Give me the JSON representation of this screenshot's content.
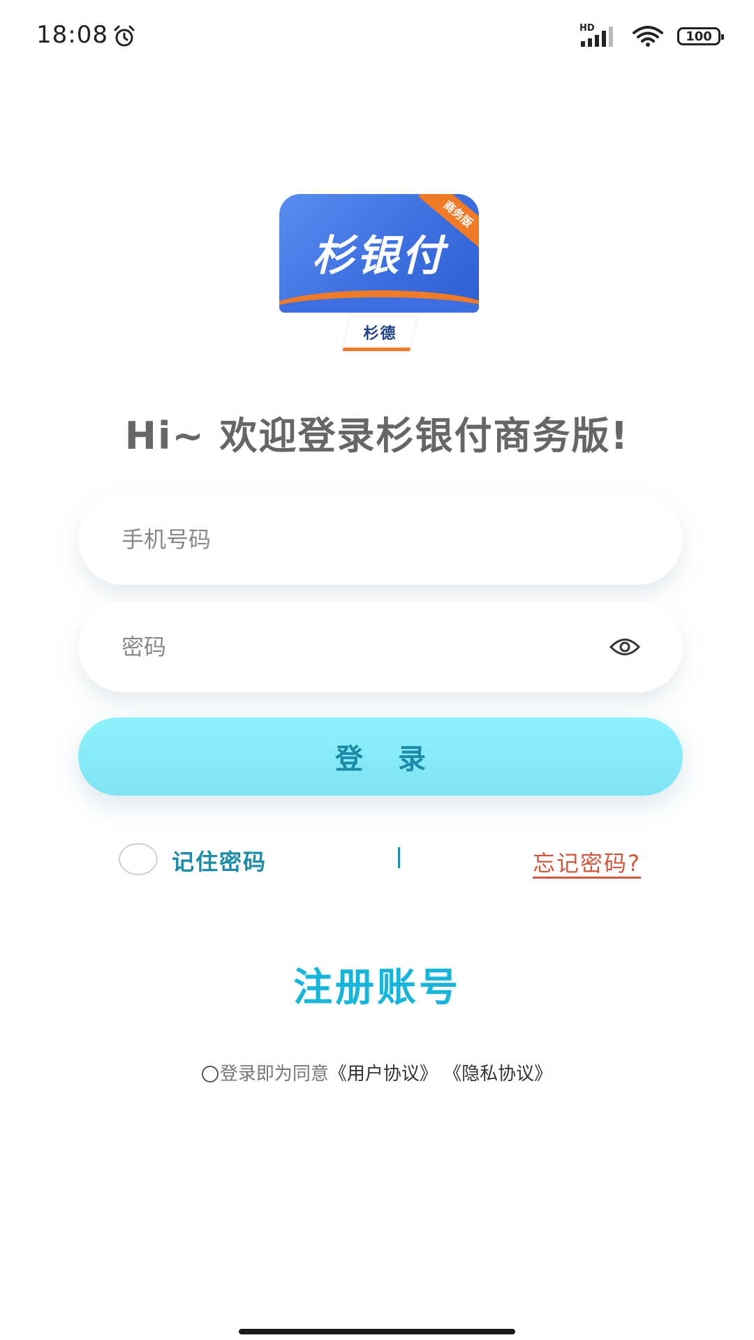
{
  "status_bar": {
    "time": "18:08",
    "hd_label": "HD",
    "battery": "100"
  },
  "logo": {
    "title": "杉银付",
    "ribbon": "商务版",
    "brand": "杉德"
  },
  "welcome": {
    "title": "Hi~ 欢迎登录杉银付商务版!"
  },
  "form": {
    "phone_placeholder": "手机号码",
    "password_placeholder": "密码",
    "login_label": "登 录"
  },
  "options": {
    "remember_label": "记住密码",
    "forgot_label": "忘记密码?"
  },
  "register": {
    "label": "注册账号"
  },
  "agreement": {
    "prefix": "登录即为同意",
    "user_agreement": "《用户协议》",
    "privacy_agreement": "《隐私协议》"
  },
  "colors": {
    "accent": "#18b5db",
    "login_button": "#8ef1fb",
    "forgot": "#d2563a",
    "logo_blue": "#3d6fe0",
    "logo_orange": "#f07a26"
  },
  "icons": {
    "alarm": "alarm-icon",
    "signal": "signal-icon",
    "wifi": "wifi-icon",
    "battery": "battery-icon",
    "eye": "eye-icon"
  }
}
